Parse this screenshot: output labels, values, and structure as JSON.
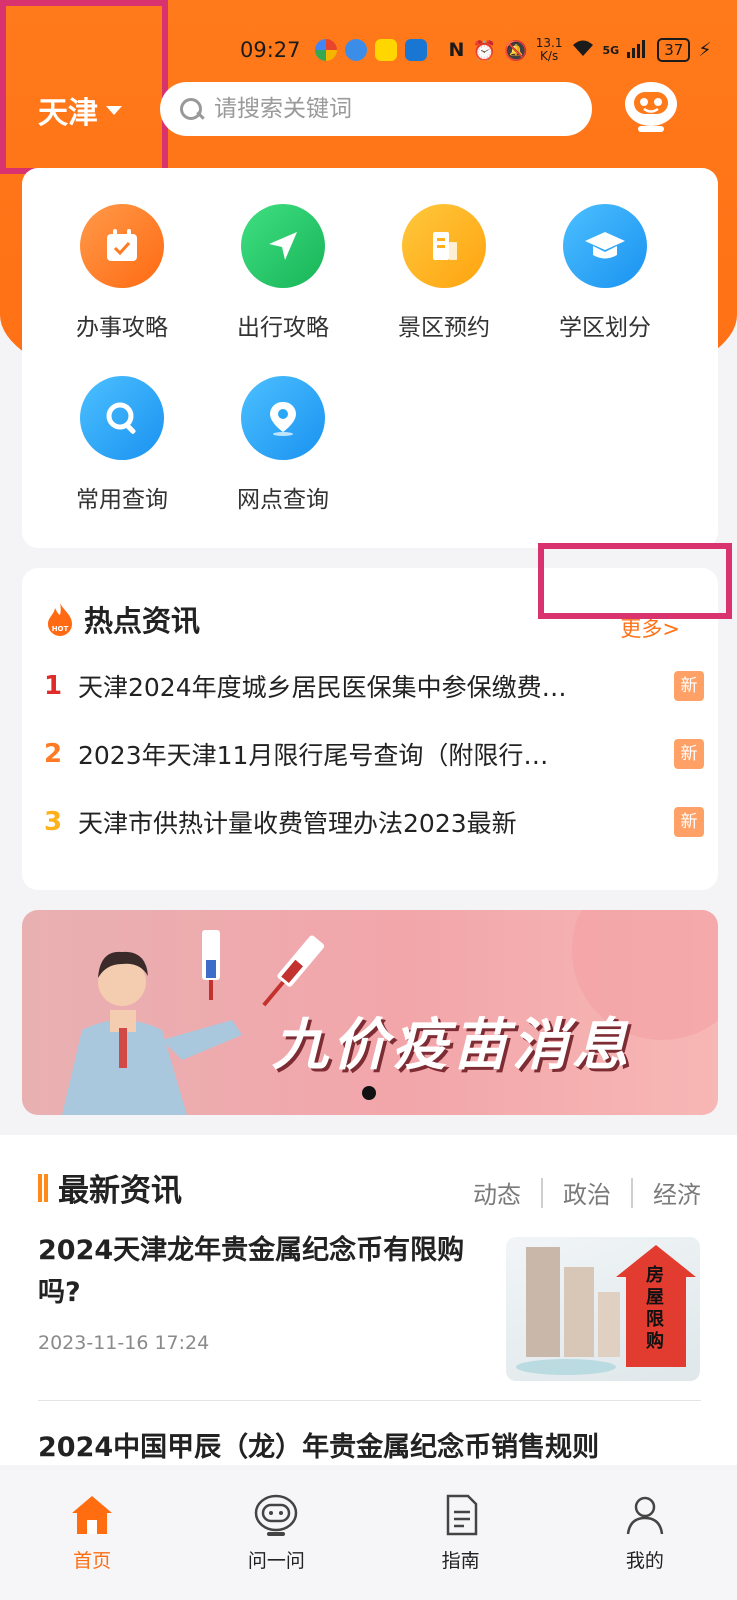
{
  "status_bar": {
    "time": "09:27",
    "net_speed_top": "13.1",
    "net_speed_bottom": "K/s",
    "signal": "5G",
    "battery": "37"
  },
  "header": {
    "city": "天津",
    "search": {
      "placeholder": "请搜索关键词"
    }
  },
  "services": [
    {
      "label": "办事攻略",
      "icon": "calendar-check-icon",
      "color": "#ff7a22"
    },
    {
      "label": "出行攻略",
      "icon": "paper-plane-icon",
      "color": "#22c466"
    },
    {
      "label": "景区预约",
      "icon": "building-icon",
      "color": "#ffb11c"
    },
    {
      "label": "学区划分",
      "icon": "graduation-cap-icon",
      "color": "#2aa7f7"
    },
    {
      "label": "常用查询",
      "icon": "magnifier-icon",
      "color": "#2aa7f7"
    },
    {
      "label": "网点查询",
      "icon": "location-pin-icon",
      "color": "#2aa7f7"
    }
  ],
  "hot": {
    "title": "热点资讯",
    "more": "更多>",
    "badge_label": "HOT",
    "items": [
      {
        "rank": "1",
        "text": "天津2024年度城乡居民医保集中参保缴费…",
        "badge": "新",
        "rank_color": "#e02b2b"
      },
      {
        "rank": "2",
        "text": "2023年天津11月限行尾号查询（附限行…",
        "badge": "新",
        "rank_color": "#ff7a22"
      },
      {
        "rank": "3",
        "text": "天津市供热计量收费管理办法2023最新",
        "badge": "新",
        "rank_color": "#ffb11c"
      }
    ]
  },
  "banner": {
    "text": "九价疫苗消息"
  },
  "latest": {
    "title": "最新资讯",
    "tabs": [
      "动态",
      "政治",
      "经济"
    ],
    "articles": [
      {
        "title": "2024天津龙年贵金属纪念币有限购吗?",
        "time": "2023-11-16 17:24",
        "thumb_text": "房屋限购"
      },
      {
        "title": "2024中国甲辰（龙）年贵金属纪念币销售规则"
      }
    ]
  },
  "tabbar": [
    {
      "label": "首页",
      "icon": "home-icon",
      "active": true
    },
    {
      "label": "问一问",
      "icon": "robot-chat-icon",
      "active": false
    },
    {
      "label": "指南",
      "icon": "document-icon",
      "active": false
    },
    {
      "label": "我的",
      "icon": "user-icon",
      "active": false
    }
  ]
}
